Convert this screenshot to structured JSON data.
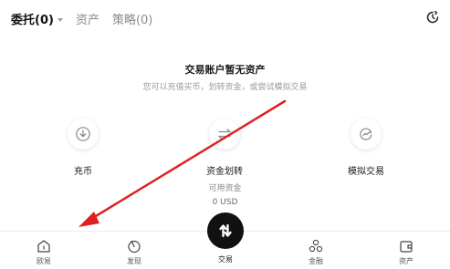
{
  "tabs": [
    {
      "label": "委托(0)",
      "active": true
    },
    {
      "label": "资产",
      "active": false
    },
    {
      "label": "策略(0)",
      "active": false
    }
  ],
  "header_icon": "clock-refresh-icon",
  "empty_state": {
    "title": "交易账户暂无资产",
    "subtitle": "您可以充值买币，划转资金，或尝试模拟交易"
  },
  "actions": [
    {
      "label": "充币",
      "icon": "download-icon"
    },
    {
      "label": "资金划转",
      "icon": "transfer-icon"
    },
    {
      "label": "模拟交易",
      "icon": "demo-trading-icon"
    }
  ],
  "available": {
    "label": "可用资金",
    "value": "0 USD"
  },
  "bottom_nav": [
    {
      "label": "欧易",
      "icon": "home-icon"
    },
    {
      "label": "发现",
      "icon": "discover-icon"
    },
    {
      "label": "交易",
      "icon": "trade-icon",
      "active": true
    },
    {
      "label": "金融",
      "icon": "finance-icon"
    },
    {
      "label": "资产",
      "icon": "wallet-icon"
    }
  ],
  "annotation_color": "#e02020"
}
